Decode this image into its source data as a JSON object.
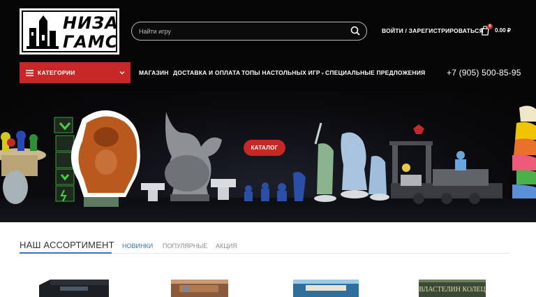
{
  "header": {
    "logo_text": "НИЗА ГАМС",
    "logo_line1": "НИЗА",
    "logo_line2": "ГАМС",
    "search_placeholder": "Найти игру",
    "login_label": "ВОЙТИ / ЗАРЕГИСТРИРОВАТЬСЯ",
    "cart_count": "0",
    "cart_total": "0.00 ₽"
  },
  "nav": {
    "categories_label": "КАТЕГОРИИ",
    "items": [
      {
        "label": "МАГАЗИН"
      },
      {
        "label": "ДОСТАВКА И ОПЛАТА"
      },
      {
        "label": "ТОПЫ НАСТОЛЬНЫХ ИГР",
        "has_dropdown": true
      },
      {
        "label": "СПЕЦИАЛЬНЫЕ ПРЕДЛОЖЕНИЯ"
      }
    ],
    "phone": "+7 (905) 500-85-95"
  },
  "hero": {
    "catalog_button": "КАТАЛОГ"
  },
  "assortment": {
    "title": "НАШ АССОРТИМЕНТ",
    "tabs": [
      {
        "label": "НОВИНКИ",
        "active": true
      },
      {
        "label": "ПОПУЛЯРНЫЕ",
        "active": false
      },
      {
        "label": "АКЦИЯ",
        "active": false
      }
    ],
    "products": [
      {
        "name": "game-box-1",
        "color": "#1b1e22"
      },
      {
        "name": "game-box-2",
        "color": "#8a5a3c"
      },
      {
        "name": "game-box-3",
        "color": "#2f6f9e"
      },
      {
        "name": "game-box-4",
        "color": "#3a4a34",
        "visible_text": "ВЛАСТЕЛИН КОЛЕЦ"
      }
    ]
  },
  "colors": {
    "accent_red": "#c62828",
    "tab_active_blue": "#3b6fb6",
    "hero_bg": "#050505"
  }
}
